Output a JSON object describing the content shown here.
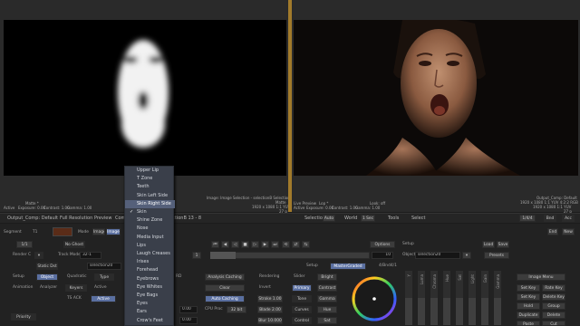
{
  "viewers": {
    "left": {
      "top_left": "Matte *",
      "info_lines": [
        "Active",
        "Exposure: 0.00",
        "Contrast: 1.00",
        "Gamma: 1.00"
      ],
      "right_lines": [
        "Image: Image Selection - selectionB Selection (RGB)",
        "Matte",
        "1920 x 1080 1:1 YUV",
        "27 p"
      ]
    },
    "right": {
      "info_lines": [
        "Live Preview",
        "Active",
        "Exposure: 0.00",
        "Contrast: 1.00",
        "Gamma: 1.00"
      ],
      "mid_lines": [
        "Lop *",
        "Look: off"
      ],
      "right_lines": [
        "Output_Comp: Default",
        "1920 x 1080 1:1 YUV 4:2:2 RGB",
        "1920 x 1080 1:1 YUV",
        "27 p"
      ]
    }
  },
  "tabbar": {
    "tabs": [
      "Output_Comp: Default",
      "Full Resolution",
      "Preview",
      "Comp"
    ],
    "center": "selectionB 13 - 8",
    "selection_label": "Selection",
    "selection_value": "Auto",
    "world_label": "World",
    "world_value": "1 Sec",
    "tools_label": "Tools",
    "tools_value": "Select",
    "right_fields": [
      "1/4/4",
      "Bnd",
      "Acc"
    ]
  },
  "row1": {
    "segment": "Segment",
    "segment_sub": "T1",
    "mode": "Mode",
    "mode_value": "Image",
    "image_tag": "Image",
    "setup": "Setup",
    "load": "Load",
    "save": "Save"
  },
  "row2": {
    "left": "1/1",
    "no_ghost": "No Ghost",
    "options": "Options",
    "setup": "Setup",
    "presets": "Presets",
    "object": "Object",
    "object_value": "selection20"
  },
  "row3": {
    "render": "Render C",
    "track_mode": "Track Mode",
    "track_value": "32-1",
    "frame": "10",
    "setup": "Setup",
    "master_graded": "MasterGraded",
    "version": "4/Bnd4/1"
  },
  "grid": {
    "static_dst": "Static Dst",
    "selection_value": "selection20",
    "setup": "Setup",
    "object": "Object",
    "quadratic": "Quadratic",
    "type": "Type",
    "animation": "Animation",
    "analyzer": "Analyzer",
    "keyers": "Keyers",
    "active": "Active",
    "ts_ack": "TS ACK",
    "active_btn": "Active",
    "priority": "Priority"
  },
  "center_panel": {
    "analysis": "Analysis Caching",
    "rd": "RD",
    "clear": "Clear",
    "auto_caching": "Auto Caching",
    "cpu_proc": "CPU Proc",
    "cpu_value": "32 bit",
    "val1": "0.00",
    "val2": "0.00"
  },
  "rendering": {
    "title": "Rendering",
    "items": [
      "Invert",
      "Stroke 1.00",
      "Blade 2.00",
      "Blur 10.000"
    ]
  },
  "color": {
    "slider": "Slider",
    "bright": "Bright",
    "primary": "Primary",
    "contrast": "Contrast",
    "tone": "Tone",
    "gamma": "Gamma",
    "curves": "Curves",
    "hue": "Hue",
    "control": "Control",
    "sat": "Sat"
  },
  "sliders": [
    "Y",
    "Luma",
    "Chroma",
    "Hue",
    "Sat",
    "Light",
    "Gain",
    "Gamma"
  ],
  "right_buttons": {
    "image_menu": "Image Menu",
    "rows": [
      [
        "Set Key",
        "Rate Key"
      ],
      [
        "Set Key",
        "Delete Key"
      ],
      [
        "Hold",
        "Group"
      ],
      [
        "Duplicate",
        "Delete"
      ],
      [
        "Paste",
        "Cut"
      ]
    ]
  },
  "menu": {
    "items": [
      "Upper Lip",
      "T Zone",
      "Teeth",
      "Skin Left Side",
      "Skin Right Side",
      "Skin",
      "Shine Zone",
      "Nose",
      "Media Input",
      "Lips",
      "Laugh Creases",
      "Irises",
      "Forehead",
      "Eyebrows",
      "Eye Whites",
      "Eye Bags",
      "Eyes",
      "Ears",
      "Crow's Feet"
    ],
    "selected": 4,
    "checked": [
      4,
      5
    ]
  },
  "colors": {
    "accent": "#5a6fa0",
    "menu_bg": "#3a3f4a",
    "menu_sel": "#55607a",
    "viewer_border": "#a27a2b"
  }
}
